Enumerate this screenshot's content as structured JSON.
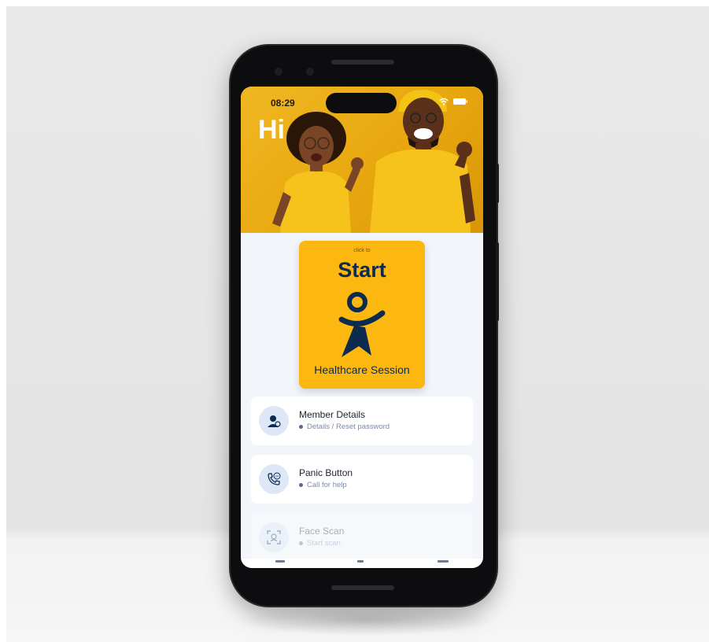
{
  "status_bar": {
    "time": "08:29"
  },
  "hero": {
    "greeting": "Hi"
  },
  "start_card": {
    "caption": "click to",
    "title": "Start",
    "subtitle": "Healthcare Session"
  },
  "menu": {
    "items": [
      {
        "title": "Member Details",
        "subtitle": "Details / Reset password",
        "icon": "member-icon"
      },
      {
        "title": "Panic Button",
        "subtitle": "Call for help",
        "icon": "phone-24-icon"
      },
      {
        "title": "Face Scan",
        "subtitle": "Start scan",
        "icon": "face-scan-icon"
      }
    ]
  },
  "colors": {
    "brand_yellow": "#fcb711",
    "brand_navy": "#0c2b4f",
    "icon_bg": "#dde7f5"
  }
}
